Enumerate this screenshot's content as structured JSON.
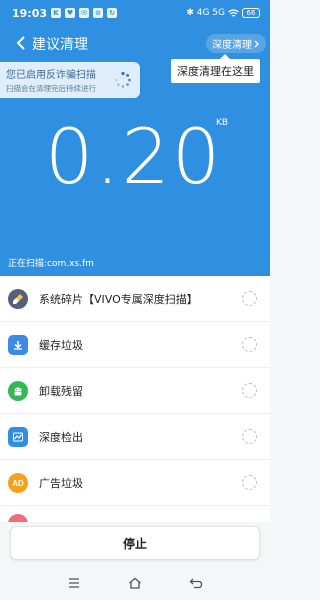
{
  "status": {
    "time": "19:03",
    "notif_icons": [
      "K",
      "♥",
      "✉",
      "⊙",
      "↻"
    ],
    "right_text": "✱ 4G 5G",
    "battery": "66"
  },
  "navbar": {
    "title": "建议清理",
    "deep_clean": "深度清理",
    "tooltip": "深度清理在这里"
  },
  "fraud_card": {
    "title": "您已启用反诈骗扫描",
    "subtitle": "扫描会在清理完后持续进行"
  },
  "scan": {
    "size": "0.20",
    "unit": "KB",
    "path": "正在扫描:com.xs.fm"
  },
  "items": [
    {
      "label": "系统碎片【VIVO专属深度扫描】",
      "icon": "broom-icon",
      "color": "#55607a"
    },
    {
      "label": "缓存垃圾",
      "icon": "download-icon",
      "color": "#3b8ae6"
    },
    {
      "label": "卸载残留",
      "icon": "android-icon",
      "color": "#32b855"
    },
    {
      "label": "深度检出",
      "icon": "chart-icon",
      "color": "#2f8fe0"
    },
    {
      "label": "广告垃圾",
      "icon": "ad-icon",
      "color": "#f4a21a"
    }
  ],
  "stop_label": "停止"
}
